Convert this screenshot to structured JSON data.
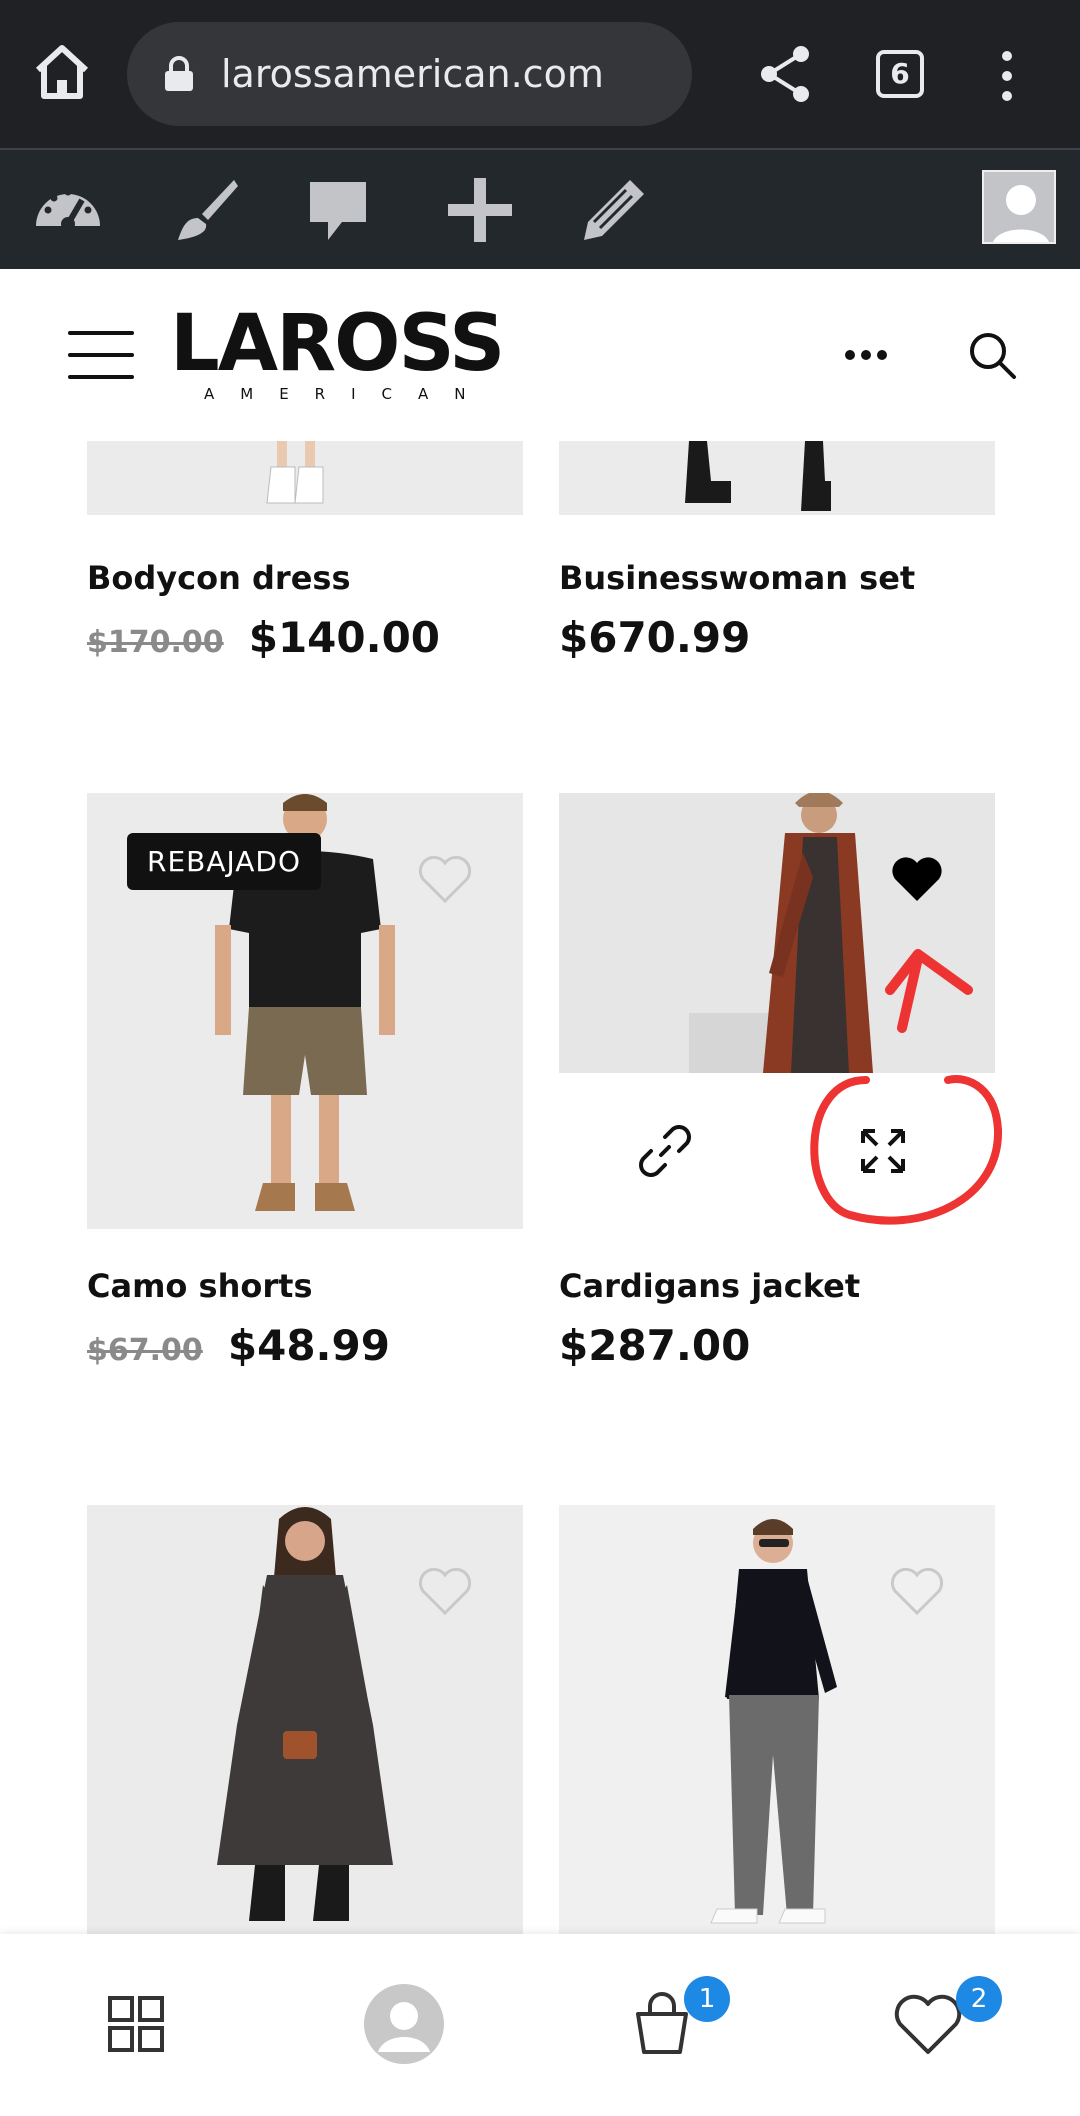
{
  "browser": {
    "url": "larossamerican.com",
    "tab_count": "6",
    "icons": [
      "home-icon",
      "lock-icon",
      "share-icon",
      "tabs-icon",
      "more-vert-icon"
    ]
  },
  "admin_bar": {
    "icons": [
      "dashboard-icon",
      "customize-brush-icon",
      "comments-icon",
      "new-plus-icon",
      "edit-pencil-icon",
      "user-avatar"
    ]
  },
  "header": {
    "logo_main": "LAROSS",
    "logo_sub": "AMERICAN",
    "icons": [
      "menu-icon",
      "more-horiz-icon",
      "search-icon"
    ]
  },
  "products": [
    {
      "name": "Bodycon dress",
      "old_price": "$170.00",
      "price": "$140.00"
    },
    {
      "name": "Businesswoman set",
      "old_price": "",
      "price": "$670.99"
    },
    {
      "name": "Camo shorts",
      "old_price": "$67.00",
      "price": "$48.99",
      "badge": "REBAJADO",
      "wishlisted": false
    },
    {
      "name": "Cardigans jacket",
      "old_price": "",
      "price": "$287.00",
      "wishlisted": true
    },
    {
      "name": "",
      "wishlisted": false
    },
    {
      "name": "",
      "wishlisted": false
    }
  ],
  "colors": {
    "browser_bg": "#202124",
    "admin_bg": "#23282d",
    "badge_bg": "#111111",
    "notify_blue": "#1e88e5",
    "annotation_red": "#ee3333"
  },
  "bottom_nav": {
    "items": [
      "shop-grid-icon",
      "account-avatar",
      "cart-bag-icon",
      "wishlist-heart-icon"
    ],
    "cart_count": "1",
    "wishlist_count": "2"
  }
}
